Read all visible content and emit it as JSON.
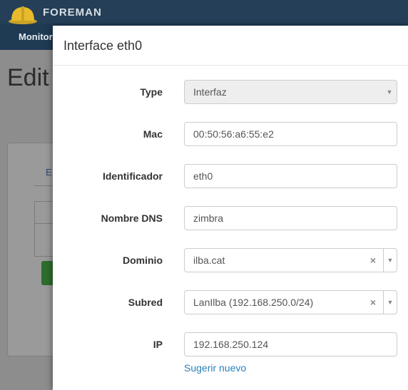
{
  "background": {
    "brand": "FOREMAN",
    "nav_item": "Monitor",
    "page_title_partial": "Edit",
    "tab_partial": "E"
  },
  "modal": {
    "title": "Interface eth0",
    "fields": {
      "type": {
        "label": "Type",
        "value": "Interfaz"
      },
      "mac": {
        "label": "Mac",
        "value": "00:50:56:a6:55:e2"
      },
      "identifier": {
        "label": "Identificador",
        "value": "eth0"
      },
      "dns_name": {
        "label": "Nombre DNS",
        "value": "zimbra"
      },
      "domain": {
        "label": "Dominio",
        "value": "ilba.cat"
      },
      "subnet": {
        "label": "Subred",
        "value": "LanIlba (192.168.250.0/24)"
      },
      "ip": {
        "label": "IP",
        "value": "192.168.250.124"
      }
    },
    "suggest_link": "Sugerir nuevo"
  },
  "colors": {
    "topbar": "#1f3a53",
    "link": "#2a80b9",
    "disabled_field": "#eeeeee"
  },
  "icons": {
    "logo": "foreman-helmet-icon",
    "dropdown": "caret-down-icon",
    "clear": "clear-x-icon"
  }
}
